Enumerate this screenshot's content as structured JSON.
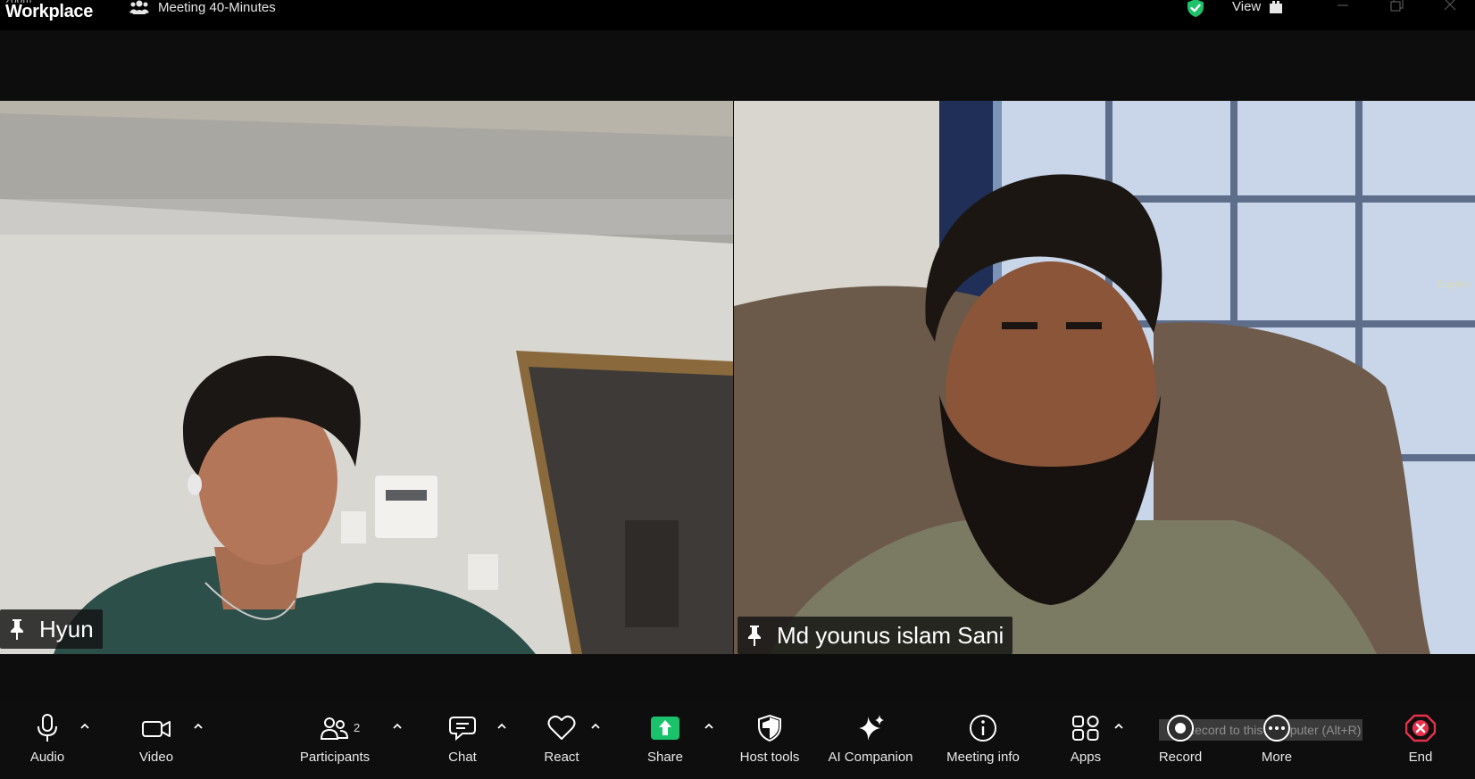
{
  "app": {
    "brand_top": "zoom",
    "brand_main": "Workplace"
  },
  "meeting": {
    "title": "Meeting 40-Minutes"
  },
  "header": {
    "view_label": "View"
  },
  "participants": [
    {
      "name": "Hyun"
    },
    {
      "name": "Md younus islam Sani"
    }
  ],
  "captions_hint": "English",
  "toolbar": {
    "audio": "Audio",
    "video": "Video",
    "participants": "Participants",
    "participants_count": "2",
    "chat": "Chat",
    "react": "React",
    "share": "Share",
    "host_tools": "Host tools",
    "ai_companion": "AI Companion",
    "meeting_info": "Meeting info",
    "apps": "Apps",
    "record": "Record",
    "more": "More",
    "end": "End"
  },
  "record_tooltip": "Record to this computer (Alt+R)",
  "colors": {
    "share_green": "#19c26b",
    "end_red": "#e8314b",
    "shield_green": "#1fc16b",
    "tile_left_wall": "#d8d6d1",
    "tile_right_chair": "#6b5a4a"
  }
}
